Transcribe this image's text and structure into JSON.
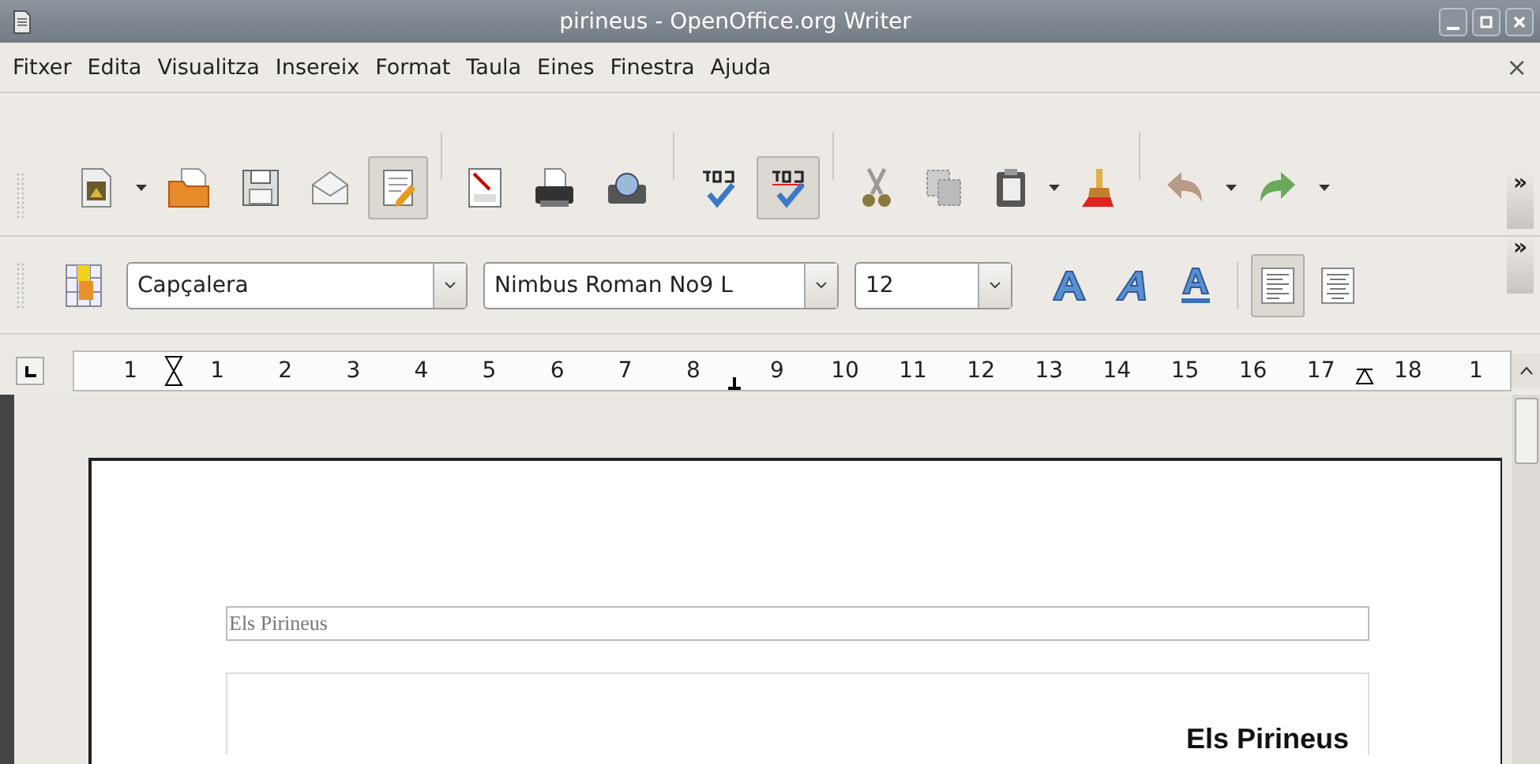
{
  "window": {
    "title": "pirineus - OpenOffice.org Writer"
  },
  "menu": {
    "items": [
      {
        "label": "Fitxer"
      },
      {
        "label": "Edita"
      },
      {
        "label": "Visualitza"
      },
      {
        "label": "Insereix"
      },
      {
        "label": "Format"
      },
      {
        "label": "Taula"
      },
      {
        "label": "Eines"
      },
      {
        "label": "Finestra"
      },
      {
        "label": "Ajuda"
      }
    ],
    "close": "×"
  },
  "standard_toolbar": {
    "buttons": [
      {
        "kind": "new",
        "selected": false,
        "dropdown": true
      },
      {
        "kind": "open",
        "selected": false,
        "dropdown": false
      },
      {
        "kind": "save",
        "selected": false,
        "dropdown": false
      },
      {
        "kind": "mail",
        "selected": false,
        "dropdown": false
      },
      {
        "kind": "edit",
        "selected": true,
        "dropdown": false
      },
      {
        "kind": "pdf",
        "selected": false,
        "dropdown": false
      },
      {
        "kind": "print",
        "selected": false,
        "dropdown": false
      },
      {
        "kind": "preview",
        "selected": false,
        "dropdown": false
      },
      {
        "kind": "spell",
        "selected": false,
        "dropdown": false
      },
      {
        "kind": "autospell",
        "selected": true,
        "dropdown": false
      },
      {
        "kind": "cut",
        "selected": false,
        "dropdown": false
      },
      {
        "kind": "copy",
        "selected": false,
        "dropdown": false
      },
      {
        "kind": "paste",
        "selected": false,
        "dropdown": true
      },
      {
        "kind": "brush",
        "selected": false,
        "dropdown": false
      },
      {
        "kind": "undo",
        "selected": false,
        "dropdown": true
      },
      {
        "kind": "redo",
        "selected": false,
        "dropdown": true
      }
    ],
    "overflow": "»"
  },
  "formatting_toolbar": {
    "style": "Capçalera",
    "font": "Nimbus Roman No9 L",
    "size": "12",
    "buttons": [
      {
        "kind": "bold",
        "selected": false
      },
      {
        "kind": "italic",
        "selected": false
      },
      {
        "kind": "underline",
        "selected": false
      },
      {
        "kind": "align-left",
        "selected": true
      },
      {
        "kind": "align-center",
        "selected": false
      }
    ],
    "overflow": "»"
  },
  "ruler": {
    "labels": [
      "1",
      "1",
      "2",
      "3",
      "4",
      "5",
      "6",
      "7",
      "8",
      "9",
      "10",
      "11",
      "12",
      "13",
      "14",
      "15",
      "16",
      "17",
      "18",
      "1"
    ]
  },
  "document": {
    "header": "Els Pirineus",
    "heading": "Els Pirineus"
  }
}
